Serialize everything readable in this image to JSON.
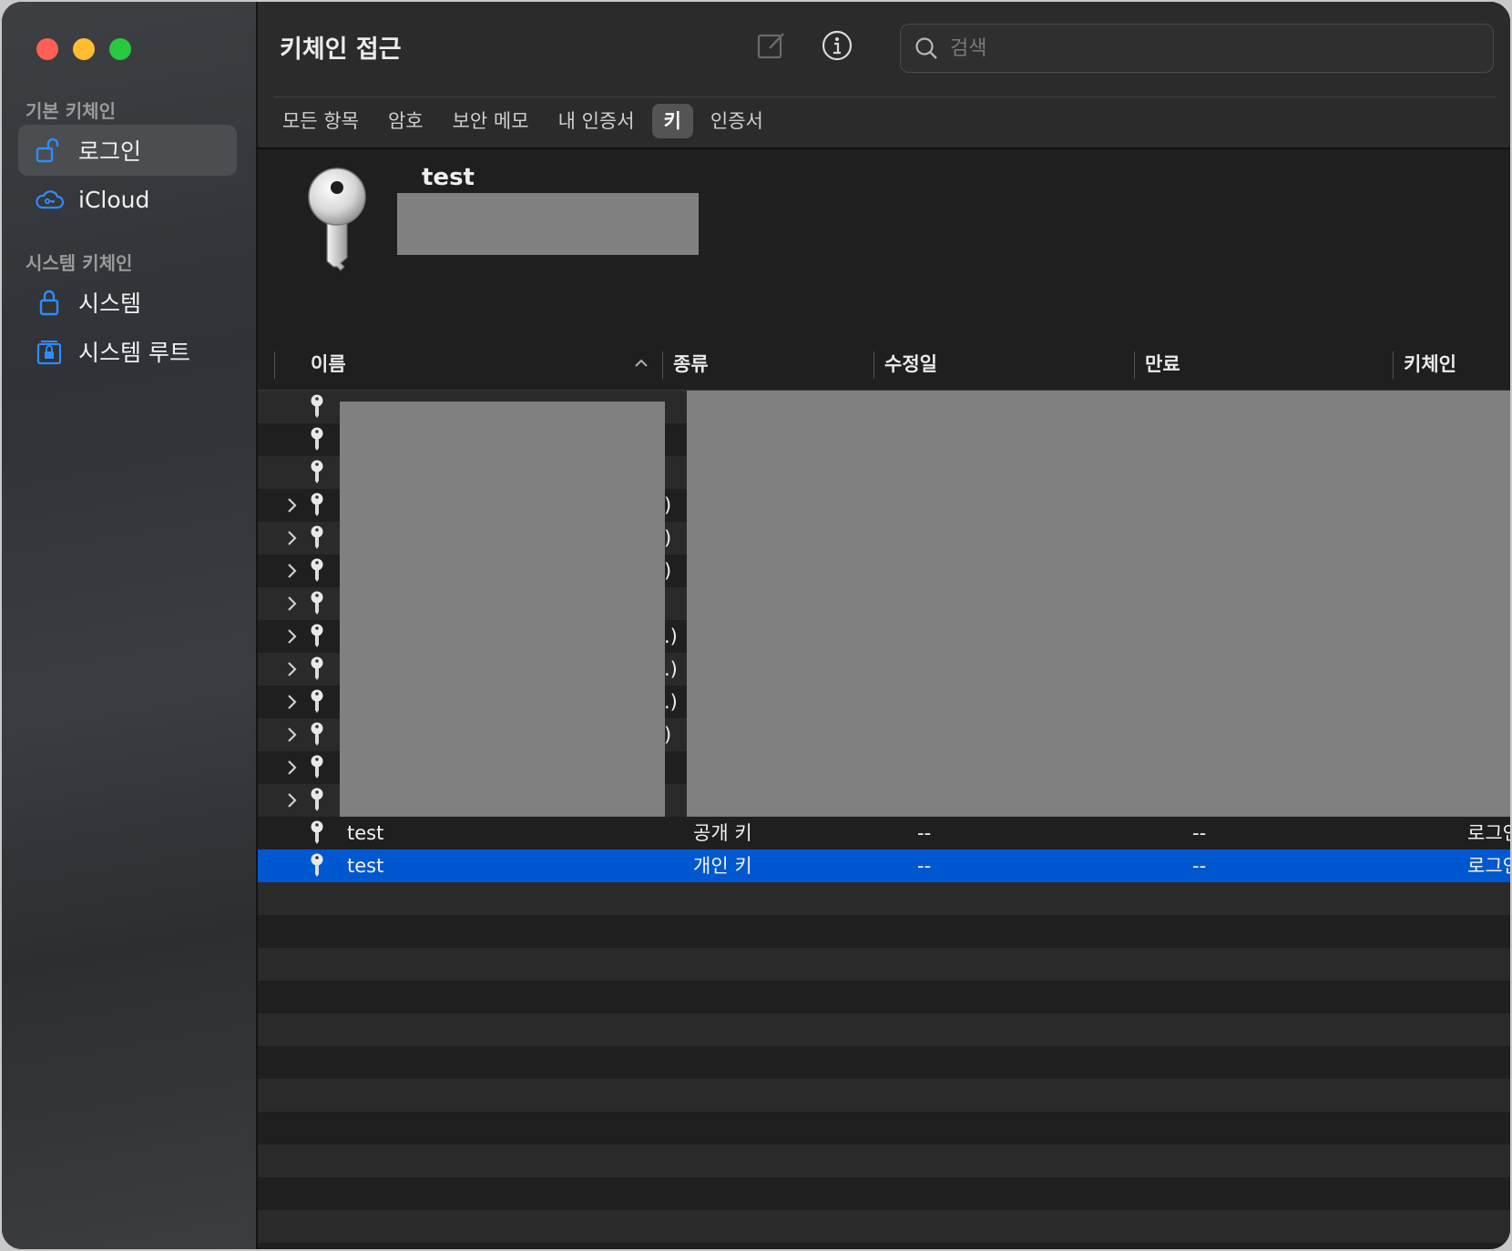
{
  "window": {
    "title": "키체인 접근"
  },
  "sidebar": {
    "default_section": "기본 키체인",
    "system_section": "시스템 키체인",
    "items": [
      {
        "label": "로그인",
        "icon": "unlock-icon",
        "active": true
      },
      {
        "label": "iCloud",
        "icon": "icloud-icon",
        "active": false
      },
      {
        "label": "시스템",
        "icon": "lock-icon",
        "active": false
      },
      {
        "label": "시스템 루트",
        "icon": "lock-cabinet-icon",
        "active": false
      }
    ]
  },
  "toolbar": {
    "compose_icon": "compose-icon",
    "info_icon": "info-icon",
    "search_placeholder": "검색"
  },
  "tabs": [
    {
      "label": "모든 항목",
      "active": false
    },
    {
      "label": "암호",
      "active": false
    },
    {
      "label": "보안 메모",
      "active": false
    },
    {
      "label": "내 인증서",
      "active": false
    },
    {
      "label": "키",
      "active": true
    },
    {
      "label": "인증서",
      "active": false
    }
  ],
  "preview": {
    "name": "test"
  },
  "table": {
    "columns": [
      "이름",
      "종류",
      "수정일",
      "만료",
      "키체인"
    ],
    "sort_column": "이름",
    "sort_direction": "ascending",
    "redacted_rows": [
      {
        "expandable": false,
        "suffix": ""
      },
      {
        "expandable": false,
        "suffix": ""
      },
      {
        "expandable": false,
        "suffix": ""
      },
      {
        "expandable": true,
        "suffix": ")"
      },
      {
        "expandable": true,
        "suffix": ")"
      },
      {
        "expandable": true,
        "suffix": ")"
      },
      {
        "expandable": true,
        "suffix": ""
      },
      {
        "expandable": true,
        "suffix": ".)"
      },
      {
        "expandable": true,
        "suffix": ".)"
      },
      {
        "expandable": true,
        "suffix": ".)"
      },
      {
        "expandable": true,
        "suffix": ")"
      },
      {
        "expandable": true,
        "suffix": ""
      },
      {
        "expandable": true,
        "suffix": ""
      }
    ],
    "rows": [
      {
        "name": "test",
        "kind": "공개 키",
        "modified": "--",
        "expires": "--",
        "keychain": "로그인",
        "selected": false
      },
      {
        "name": "test",
        "kind": "개인 키",
        "modified": "--",
        "expires": "--",
        "keychain": "로그인",
        "selected": true
      }
    ]
  },
  "colors": {
    "selection": "#0058d1",
    "accent_icon": "#2f8cff"
  }
}
